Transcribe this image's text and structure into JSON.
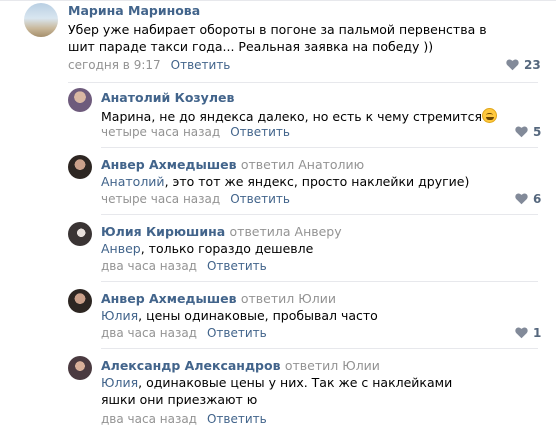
{
  "ui": {
    "like_icon": "heart-icon",
    "link_color": "#42648b",
    "meta_color": "#939393"
  },
  "comments": [
    {
      "author": "Марина Маринова",
      "text": "Убер уже набирает обороты в погоне за пальмой первенства в шит параде такси года... Реальная заявка на победу ))",
      "time": "сегодня в 9:17",
      "reply_label": "Ответить",
      "likes": "23"
    },
    {
      "author": "Анатолий Козулев",
      "text": "Марина, не до яндекса далеко, но есть к чему стремится",
      "time": "четыре часа назад",
      "reply_label": "Ответить",
      "likes": "5"
    },
    {
      "author": "Анвер Ахмедышев",
      "replied_to": "ответил Анатолию",
      "address": "Анатолий",
      "text": ", это тот же яндекс, просто наклейки другие)",
      "time": "четыре часа назад",
      "reply_label": "Ответить",
      "likes": "6"
    },
    {
      "author": "Юлия Кирюшина",
      "replied_to": "ответила Анверу",
      "address": "Анвер",
      "text": ", только гораздо дешевле",
      "time": "два часа назад",
      "reply_label": "Ответить"
    },
    {
      "author": "Анвер Ахмедышев",
      "replied_to": "ответил Юлии",
      "address": "Юлия",
      "text": ", цены одинаковые, пробывал часто",
      "time": "два часа назад",
      "reply_label": "Ответить",
      "likes": "1"
    },
    {
      "author": "Александр Александров",
      "replied_to": "ответил Юлии",
      "address": "Юлия",
      "text": ", одинаковые цены у них. Так же с наклейками яшки они приезжают ю",
      "time": "два часа назад",
      "reply_label": "Ответить"
    }
  ]
}
